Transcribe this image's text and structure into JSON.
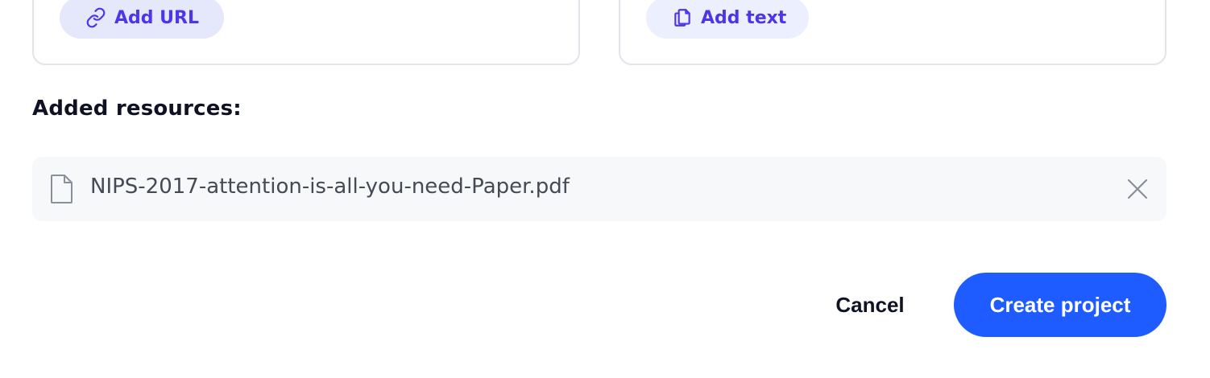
{
  "sources": {
    "add_url_label": "Add URL",
    "add_text_label": "Add text"
  },
  "resources": {
    "title": "Added resources:",
    "items": [
      {
        "name": "NIPS-2017-attention-is-all-you-need-Paper.pdf",
        "icon": "file-icon"
      }
    ]
  },
  "footer": {
    "cancel_label": "Cancel",
    "create_label": "Create project"
  },
  "colors": {
    "accent": "#4f35e8",
    "primary_button": "#1f5cff",
    "pill_bg": "#e5e7fb",
    "row_bg": "#f7f8fa"
  }
}
